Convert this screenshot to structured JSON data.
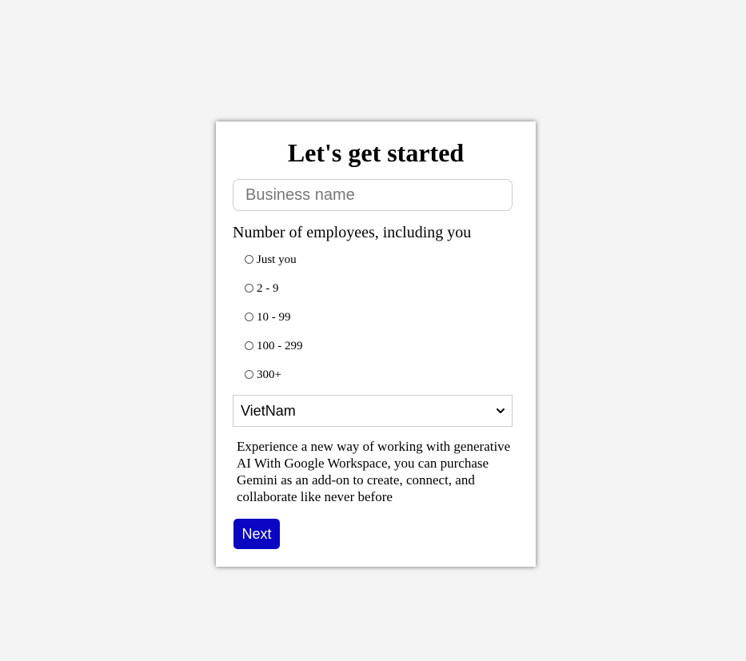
{
  "form": {
    "title": "Let's get started",
    "business_name_placeholder": "Business name",
    "business_name_value": "",
    "employees_label": "Number of employees, including you",
    "employee_options": [
      {
        "label": "Just you",
        "checked": false
      },
      {
        "label": "2 - 9",
        "checked": false
      },
      {
        "label": "10 - 99",
        "checked": false
      },
      {
        "label": "100 - 299",
        "checked": false
      },
      {
        "label": "300+",
        "checked": false
      }
    ],
    "country_selected": "VietNam",
    "description": "Experience a new way of working with generative AI With Google Workspace, you can purchase Gemini as an add-on to create, connect, and collaborate like never before",
    "next_label": "Next"
  },
  "colors": {
    "page_background": "#f4f4f4",
    "card_background": "#ffffff",
    "button_background": "#0a06c2",
    "button_text": "#ffffff",
    "border": "#cccccc"
  },
  "icons": {
    "select_arrow": "chevron-down-icon"
  }
}
